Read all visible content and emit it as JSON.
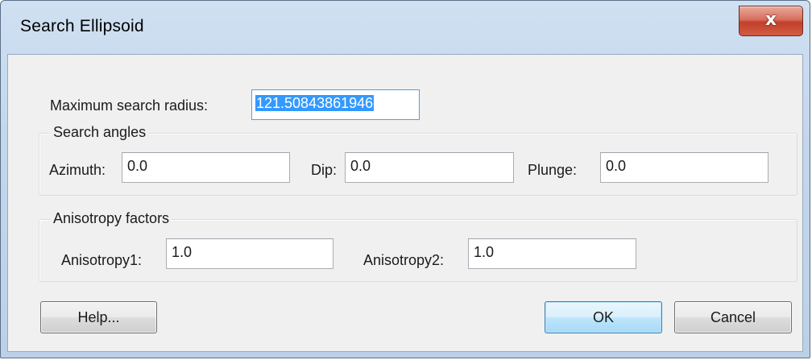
{
  "window": {
    "title": "Search Ellipsoid",
    "close_glyph": "x"
  },
  "max_radius": {
    "label": "Maximum search radius:",
    "value": "121.50843861946"
  },
  "search_angles": {
    "title": "Search angles",
    "azimuth_label": "Azimuth:",
    "azimuth_value": "0.0",
    "dip_label": "Dip:",
    "dip_value": "0.0",
    "plunge_label": "Plunge:",
    "plunge_value": "0.0"
  },
  "anisotropy": {
    "title": "Anisotropy factors",
    "a1_label": "Anisotropy1:",
    "a1_value": "1.0",
    "a2_label": "Anisotropy2:",
    "a2_value": "1.0"
  },
  "buttons": {
    "help": "Help...",
    "ok": "OK",
    "cancel": "Cancel"
  },
  "colors": {
    "selection": "#3399ff",
    "default_button_border": "#3c7fb1",
    "close_button": "#c2402b"
  },
  "icons": {
    "close": "close-icon"
  }
}
